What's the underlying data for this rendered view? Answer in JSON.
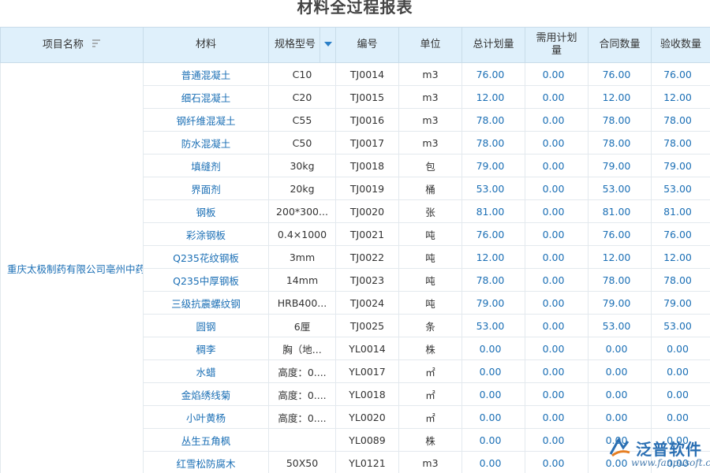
{
  "report": {
    "title": "材料全过程报表"
  },
  "columns": {
    "project": "项目名称",
    "material": "材料",
    "spec": "规格型号",
    "code": "编号",
    "unit": "单位",
    "total_plan": "总计划量",
    "demand_plan": "需用计划量",
    "contract_qty": "合同数量",
    "accept_qty": "验收数量"
  },
  "project_name": "重庆太极制药有限公司亳州中药",
  "rows": [
    {
      "material": "普通混凝土",
      "spec": "C10",
      "code": "TJ0014",
      "unit": "m3",
      "total": "76.00",
      "demand": "0.00",
      "contract": "76.00",
      "accept": "76.00"
    },
    {
      "material": "细石混凝土",
      "spec": "C20",
      "code": "TJ0015",
      "unit": "m3",
      "total": "12.00",
      "demand": "0.00",
      "contract": "12.00",
      "accept": "12.00"
    },
    {
      "material": "钢纤维混凝土",
      "spec": "C55",
      "code": "TJ0016",
      "unit": "m3",
      "total": "78.00",
      "demand": "0.00",
      "contract": "78.00",
      "accept": "78.00"
    },
    {
      "material": "防水混凝土",
      "spec": "C50",
      "code": "TJ0017",
      "unit": "m3",
      "total": "78.00",
      "demand": "0.00",
      "contract": "78.00",
      "accept": "78.00"
    },
    {
      "material": "填缝剂",
      "spec": "30kg",
      "code": "TJ0018",
      "unit": "包",
      "total": "79.00",
      "demand": "0.00",
      "contract": "79.00",
      "accept": "79.00"
    },
    {
      "material": "界面剂",
      "spec": "20kg",
      "code": "TJ0019",
      "unit": "桶",
      "total": "53.00",
      "demand": "0.00",
      "contract": "53.00",
      "accept": "53.00"
    },
    {
      "material": "钢板",
      "spec": "200*300...",
      "code": "TJ0020",
      "unit": "张",
      "total": "81.00",
      "demand": "0.00",
      "contract": "81.00",
      "accept": "81.00"
    },
    {
      "material": "彩涂钢板",
      "spec": "0.4×1000",
      "code": "TJ0021",
      "unit": "吨",
      "total": "76.00",
      "demand": "0.00",
      "contract": "76.00",
      "accept": "76.00"
    },
    {
      "material": "Q235花纹钢板",
      "spec": "3mm",
      "code": "TJ0022",
      "unit": "吨",
      "total": "12.00",
      "demand": "0.00",
      "contract": "12.00",
      "accept": "12.00"
    },
    {
      "material": "Q235中厚钢板",
      "spec": "14mm",
      "code": "TJ0023",
      "unit": "吨",
      "total": "78.00",
      "demand": "0.00",
      "contract": "78.00",
      "accept": "78.00"
    },
    {
      "material": "三级抗震螺纹钢",
      "spec": "HRB400...",
      "code": "TJ0024",
      "unit": "吨",
      "total": "79.00",
      "demand": "0.00",
      "contract": "79.00",
      "accept": "79.00"
    },
    {
      "material": "圆钢",
      "spec": "6厘",
      "code": "TJ0025",
      "unit": "条",
      "total": "53.00",
      "demand": "0.00",
      "contract": "53.00",
      "accept": "53.00"
    },
    {
      "material": "稠李",
      "spec": "胸（地...",
      "code": "YL0014",
      "unit": "株",
      "total": "0.00",
      "demand": "0.00",
      "contract": "0.00",
      "accept": "0.00"
    },
    {
      "material": "水蜡",
      "spec": "高度：0....",
      "code": "YL0017",
      "unit": "㎡",
      "total": "0.00",
      "demand": "0.00",
      "contract": "0.00",
      "accept": "0.00"
    },
    {
      "material": "金焰绣线菊",
      "spec": "高度：0....",
      "code": "YL0018",
      "unit": "㎡",
      "total": "0.00",
      "demand": "0.00",
      "contract": "0.00",
      "accept": "0.00"
    },
    {
      "material": "小叶黄杨",
      "spec": "高度：0....",
      "code": "YL0020",
      "unit": "㎡",
      "total": "0.00",
      "demand": "0.00",
      "contract": "0.00",
      "accept": "0.00"
    },
    {
      "material": "丛生五角枫",
      "spec": "",
      "code": "YL0089",
      "unit": "株",
      "total": "0.00",
      "demand": "0.00",
      "contract": "0.00",
      "accept": "0.00"
    },
    {
      "material": "红雪松防腐木",
      "spec": "50X50",
      "code": "YL0121",
      "unit": "m3",
      "total": "0.00",
      "demand": "0.00",
      "contract": "0.00",
      "accept": "0.00"
    }
  ],
  "watermark": {
    "brand": "泛普软件",
    "url": "www.fanpusoft.com"
  },
  "icons": {
    "sort": "sort-icon",
    "filter": "filter-dropdown-icon",
    "logo": "fanpu-logo-icon"
  },
  "colors": {
    "header_bg": "#dff0fb",
    "link_blue": "#1b6fb5",
    "spec_header": "#e67e22"
  }
}
